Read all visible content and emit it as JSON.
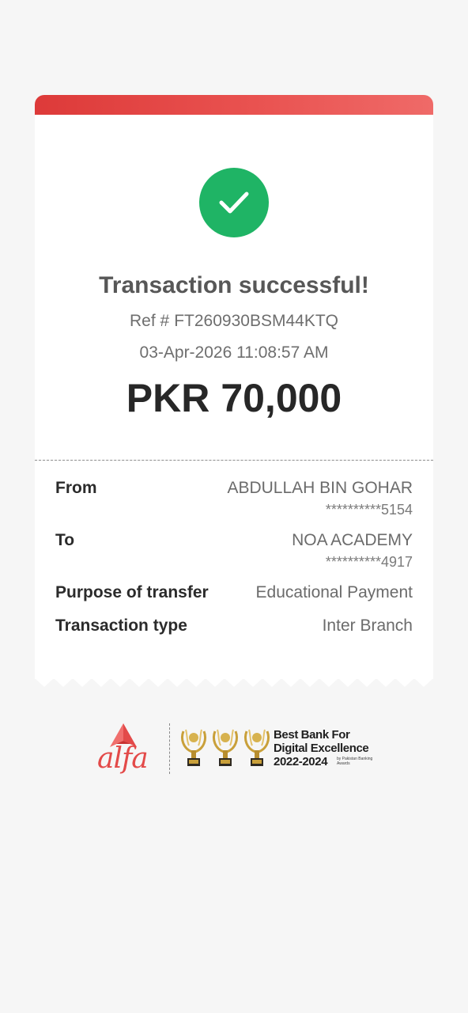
{
  "receipt": {
    "title": "Transaction successful!",
    "ref_label": "Ref #",
    "ref_number": "FT260930BSM44KTQ",
    "datetime": "03-Apr-2026 11:08:57 AM",
    "amount_currency": "PKR",
    "amount_value": "70,000"
  },
  "details": {
    "from_label": "From",
    "from_name": "ABDULLAH BIN GOHAR",
    "from_account": "**********5154",
    "to_label": "To",
    "to_name": "NOA ACADEMY",
    "to_account": "**********4917",
    "purpose_label": "Purpose of transfer",
    "purpose_value": "Educational Payment",
    "type_label": "Transaction type",
    "type_value": "Inter Branch"
  },
  "footer": {
    "brand_logo": "alfa",
    "award_line_1": "Best Bank For",
    "award_line_2": "Digital Excellence",
    "award_line_3": "2022-2024",
    "award_by": "by Pakistan Banking Awards"
  },
  "colors": {
    "success": "#1fb465",
    "brand_red": "#e34a49",
    "background": "#f6f6f6"
  },
  "icons": {
    "status": "checkmark-icon",
    "trophy": "trophy-icon"
  }
}
